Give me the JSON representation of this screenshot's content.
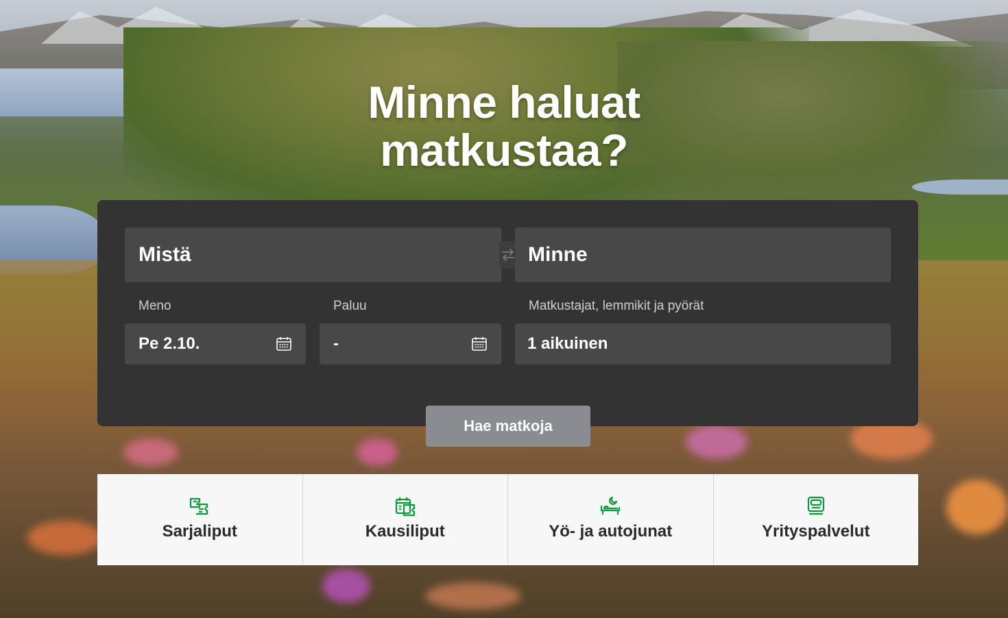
{
  "hero": {
    "title_line1": "Minne haluat",
    "title_line2": "matkustaa?"
  },
  "search": {
    "from_placeholder": "Mistä",
    "to_placeholder": "Minne",
    "swap_icon": "swap-arrows-icon",
    "departure_label": "Meno",
    "departure_value": "Pe 2.10.",
    "return_label": "Paluu",
    "return_value": "-",
    "passengers_label": "Matkustajat, lemmikit ja pyörät",
    "passengers_value": "1 aikuinen",
    "calendar_icon": "calendar-icon",
    "submit_label": "Hae matkoja"
  },
  "quick_links": [
    {
      "label": "Sarjaliput",
      "icon": "multi-ticket-icon"
    },
    {
      "label": "Kausiliput",
      "icon": "season-ticket-icon"
    },
    {
      "label": "Yö- ja autojunat",
      "icon": "night-train-icon"
    },
    {
      "label": "Yrityspalvelut",
      "icon": "business-icon"
    }
  ],
  "colors": {
    "panel_bg": "#333333",
    "field_bg": "#484848",
    "button_bg": "#8a8c91",
    "icon_green": "#0c9b3a"
  }
}
